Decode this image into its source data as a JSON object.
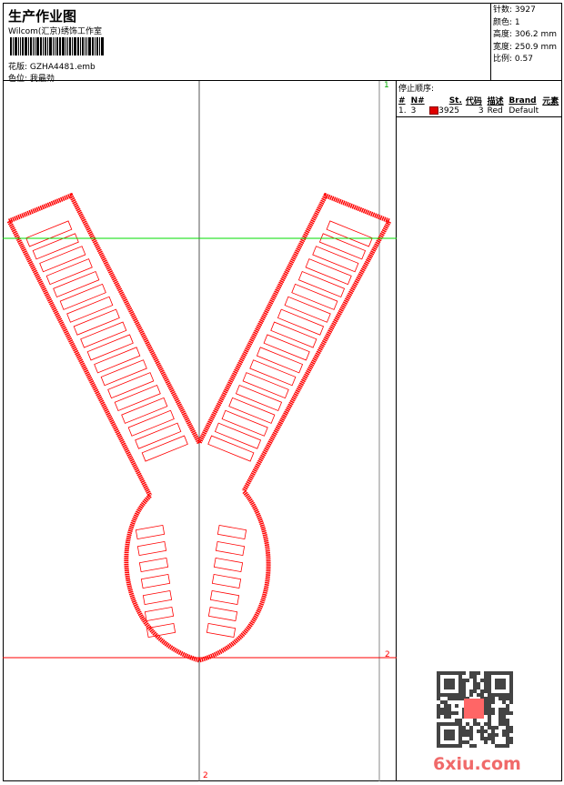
{
  "header": {
    "title": "生产作业图",
    "company": "Wilcom(汇京)绣饰工作室",
    "design_label": "花版:",
    "design_value": "GZHA4481.emb",
    "colorpos_label": "色位:",
    "colorpos_value": "我最劲"
  },
  "info": {
    "stitches": "针数: 3927",
    "colors": "颜色: 1",
    "height": "高度: 306.2 mm",
    "width": "宽度: 250.9 mm",
    "scale": "比例: 0.57"
  },
  "stop_sequence": {
    "title": "停止顺序:",
    "columns": [
      "#",
      "N#",
      "St.",
      "代码",
      "描述",
      "Brand",
      "元素"
    ],
    "rows": [
      {
        "index": "1.",
        "n": "3",
        "color": "#e00000",
        "stitches": "3925",
        "code": "3",
        "desc": "Red",
        "brand": "Default"
      }
    ]
  },
  "markers": {
    "top_right": "1",
    "right_bottom": "2",
    "bottom": "2"
  },
  "watermark": {
    "text": "6xiu.com"
  },
  "colors": {
    "thread": "#ff0000",
    "guide_green": "#00dd00",
    "guide_red": "#ff0000"
  }
}
